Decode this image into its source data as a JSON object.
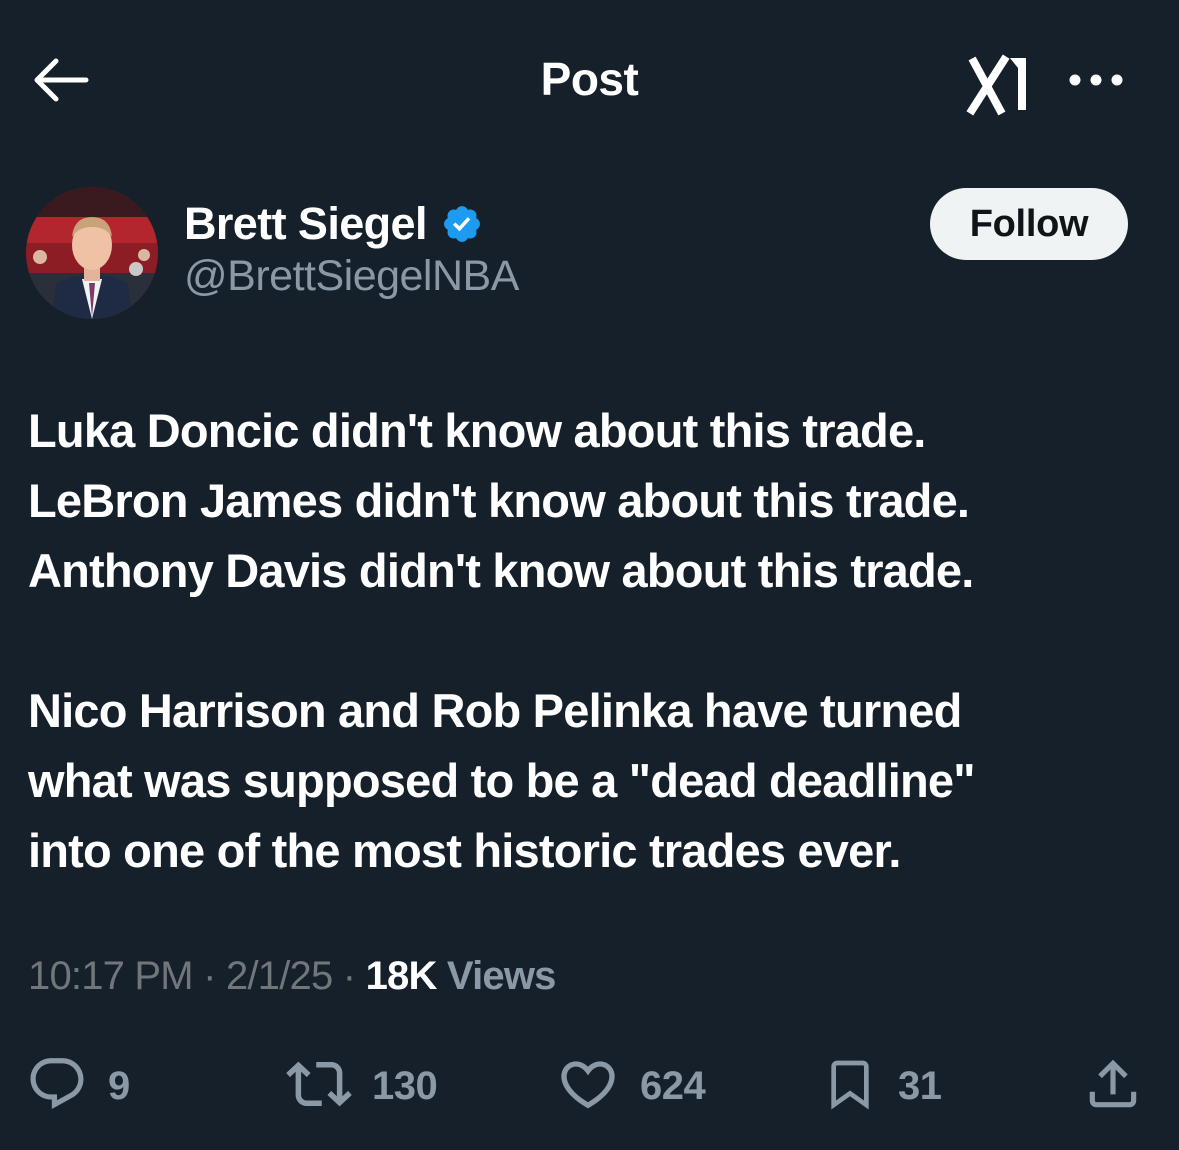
{
  "header": {
    "title": "Post",
    "back_icon": "arrow-left-icon",
    "grok_icon": "grok-icon",
    "more_icon": "more-dots-icon"
  },
  "author": {
    "name": "Brett Siegel",
    "handle": "@BrettSiegelNBA",
    "verified": true,
    "verified_color": "#1d9bf0",
    "follow_label": "Follow"
  },
  "tweet": {
    "lines": [
      "Luka Doncic didn't know about this trade.",
      "LeBron James didn't know about this trade.",
      "Anthony Davis didn't know about this trade.",
      "",
      "Nico Harrison and Rob Pelinka have turned",
      "what was supposed to be a \"dead deadline\"",
      "into one of the most historic trades ever."
    ]
  },
  "meta": {
    "time": "10:17 PM",
    "separator": "·",
    "date": "2/1/25",
    "views_count": "18K",
    "views_label": "Views"
  },
  "actions": {
    "replies": "9",
    "reposts": "130",
    "likes": "624",
    "bookmarks": "31"
  },
  "colors": {
    "background": "#15202b",
    "text_primary": "#ffffff",
    "text_secondary": "#8b98a5",
    "follow_bg": "#eff3f4"
  }
}
